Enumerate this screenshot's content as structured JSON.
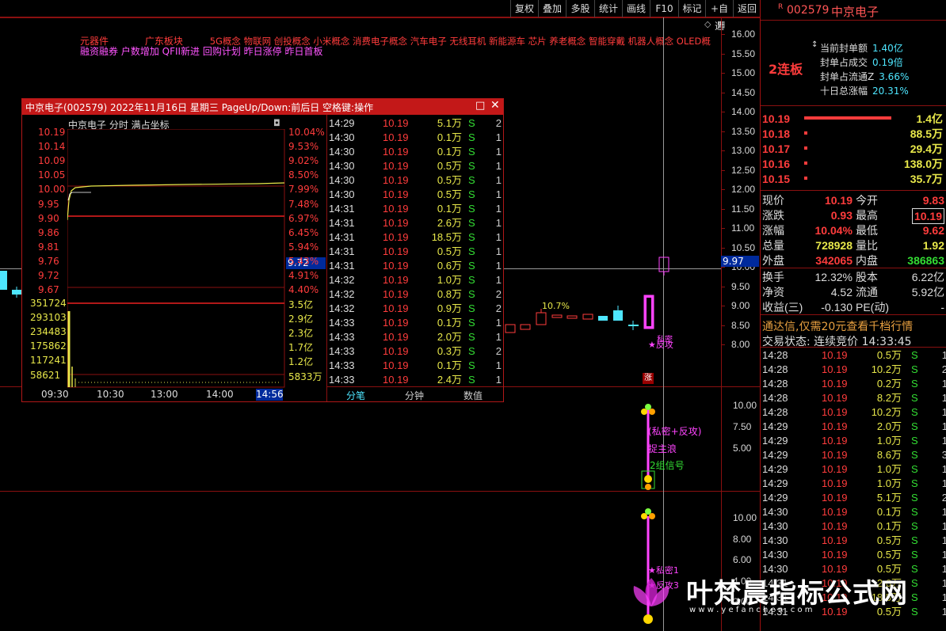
{
  "toolbar": {
    "items": [
      "复权",
      "叠加",
      "多股",
      "统计",
      "画线",
      "F10",
      "标记",
      "+自选",
      "返回"
    ]
  },
  "stock": {
    "badge": "R",
    "code": "002579",
    "name": "中京电子"
  },
  "concept_tags": {
    "line1": [
      {
        "t": "元器件",
        "c": "#ff3c3c"
      },
      {
        "t": "广东板块",
        "c": "#ff3c3c"
      },
      {
        "t": "5G概念 物联网 创投概念 小米概念 消费电子概念 汽车电子 无线耳机 新能源车 芯片 养老概念 智能穿戴 机器人概念 OLED概",
        "c": "#ff3c3c"
      }
    ],
    "line2": "融资融券 户数增加 QFII新进 回购计划 昨日涨停 昨日首板"
  },
  "main_axis": [
    "16.00",
    "15.50",
    "15.00",
    "14.50",
    "14.00",
    "13.50",
    "13.00",
    "12.50",
    "12.00",
    "11.50",
    "11.00",
    "10.50",
    "10.00",
    "9.50",
    "9.00",
    "8.50",
    "8.00"
  ],
  "price_box": "9.97",
  "pct_label": "10.7%",
  "signals": {
    "zhang": "涨",
    "rev": "★反攻",
    "ji": "私密",
    "s1": "(私密+反攻)",
    "s2": "捉主浪",
    "s3": "2组信号",
    "s4": "★私密1",
    "s5": "★反攻3"
  },
  "ind1_axis": [
    "10.00",
    "7.50",
    "5.00"
  ],
  "ind2_axis": [
    "10.00",
    "8.00",
    "6.00",
    "4.00",
    "2.00"
  ],
  "popup": {
    "title": "中京电子(002579)  2022年11月16日  星期三  PageUp/Down:前后日  空格键:操作",
    "chart_title": "中京电子  分时  满占坐标",
    "left_axis": [
      "10.19",
      "10.14",
      "10.09",
      "10.05",
      "10.00",
      "9.95",
      "9.90",
      "9.86",
      "9.81",
      "9.76",
      "9.72",
      "9.67"
    ],
    "right_axis": [
      "10.04%",
      "9.53%",
      "9.02%",
      "8.50%",
      "7.99%",
      "7.48%",
      "6.97%",
      "6.45%",
      "5.94%",
      "5.43%",
      "4.91%",
      "4.40%"
    ],
    "cur_price": "9.72",
    "vol_left": [
      "351724",
      "293103",
      "234483",
      "175862",
      "117241",
      "58621"
    ],
    "vol_right": [
      "3.5亿",
      "2.9亿",
      "2.3亿",
      "1.7亿",
      "1.2亿",
      "5833万"
    ],
    "times": [
      "09:30",
      "10:30",
      "13:00",
      "14:00"
    ],
    "time_end": "14:56",
    "ticks": [
      [
        "14:29",
        "10.19",
        "5.1万",
        "S",
        "2"
      ],
      [
        "14:30",
        "10.19",
        "0.1万",
        "S",
        "1"
      ],
      [
        "14:30",
        "10.19",
        "0.1万",
        "S",
        "1"
      ],
      [
        "14:30",
        "10.19",
        "0.5万",
        "S",
        "1"
      ],
      [
        "14:30",
        "10.19",
        "0.5万",
        "S",
        "1"
      ],
      [
        "14:30",
        "10.19",
        "0.5万",
        "S",
        "1"
      ],
      [
        "14:31",
        "10.19",
        "0.1万",
        "S",
        "1"
      ],
      [
        "14:31",
        "10.19",
        "2.6万",
        "S",
        "1"
      ],
      [
        "14:31",
        "10.19",
        "18.5万",
        "S",
        "1"
      ],
      [
        "14:31",
        "10.19",
        "0.5万",
        "S",
        "1"
      ],
      [
        "14:31",
        "10.19",
        "0.6万",
        "S",
        "1"
      ],
      [
        "14:32",
        "10.19",
        "1.0万",
        "S",
        "1"
      ],
      [
        "14:32",
        "10.19",
        "0.8万",
        "S",
        "2"
      ],
      [
        "14:32",
        "10.19",
        "0.9万",
        "S",
        "2"
      ],
      [
        "14:33",
        "10.19",
        "0.1万",
        "S",
        "1"
      ],
      [
        "14:33",
        "10.19",
        "2.0万",
        "S",
        "1"
      ],
      [
        "14:33",
        "10.19",
        "0.3万",
        "S",
        "2"
      ],
      [
        "14:33",
        "10.19",
        "0.1万",
        "S",
        "1"
      ],
      [
        "14:33",
        "10.19",
        "2.4万",
        "S",
        "1"
      ]
    ],
    "tabs": [
      "分笔",
      "分钟",
      "数值"
    ]
  },
  "side": {
    "board": "2连板",
    "seal": [
      [
        "当前封单额",
        "1.40亿"
      ],
      [
        "封单占成交",
        "0.19倍"
      ],
      [
        "封单占流通Z",
        "3.66%"
      ],
      [
        "十日总涨幅",
        "20.31%"
      ]
    ],
    "book": [
      [
        "10.19",
        "1.4亿"
      ],
      [
        "10.18",
        "88.5万"
      ],
      [
        "10.17",
        "29.4万"
      ],
      [
        "10.16",
        "138.0万"
      ],
      [
        "10.15",
        "35.7万"
      ]
    ],
    "quote": [
      [
        "现价",
        "10.19",
        "今开",
        "9.83"
      ],
      [
        "涨跌",
        "0.93",
        "最高",
        "10.19"
      ],
      [
        "涨幅",
        "10.04%",
        "最低",
        "9.62"
      ],
      [
        "总量",
        "728928",
        "量比",
        "1.92"
      ],
      [
        "外盘",
        "342065",
        "内盘",
        "386863"
      ]
    ],
    "fund": [
      [
        "换手",
        "12.32%",
        "股本",
        "6.22亿"
      ],
      [
        "净资",
        "4.52",
        "流通",
        "5.92亿"
      ],
      [
        "收益(三)",
        "-0.130",
        "PE(动)",
        "-"
      ]
    ],
    "promo": "通达信,仅需20元查看千档行情",
    "status_label": "交易状态: 连续竞价",
    "status_time": "14:33:45",
    "ticks": [
      [
        "14:28",
        "10.19",
        "0.5万",
        "S",
        "1"
      ],
      [
        "14:28",
        "10.19",
        "10.2万",
        "S",
        "2"
      ],
      [
        "14:28",
        "10.19",
        "0.2万",
        "S",
        "1"
      ],
      [
        "14:28",
        "10.19",
        "8.2万",
        "S",
        "1"
      ],
      [
        "14:28",
        "10.19",
        "10.2万",
        "S",
        "1"
      ],
      [
        "14:29",
        "10.19",
        "2.0万",
        "S",
        "1"
      ],
      [
        "14:29",
        "10.19",
        "1.0万",
        "S",
        "1"
      ],
      [
        "14:29",
        "10.19",
        "8.6万",
        "S",
        "3"
      ],
      [
        "14:29",
        "10.19",
        "1.0万",
        "S",
        "1"
      ],
      [
        "14:29",
        "10.19",
        "1.0万",
        "S",
        "1"
      ],
      [
        "14:29",
        "10.19",
        "5.1万",
        "S",
        "2"
      ],
      [
        "14:30",
        "10.19",
        "0.1万",
        "S",
        "1"
      ],
      [
        "14:30",
        "10.19",
        "0.1万",
        "S",
        "1"
      ],
      [
        "14:30",
        "10.19",
        "0.5万",
        "S",
        "1"
      ],
      [
        "14:30",
        "10.19",
        "0.5万",
        "S",
        "1"
      ],
      [
        "14:30",
        "10.19",
        "0.5万",
        "S",
        "1"
      ],
      [
        "14:31",
        "10.19",
        "2.6万",
        "S",
        "1"
      ],
      [
        "14:31",
        "10.19",
        "18.5万",
        "S",
        "1"
      ],
      [
        "14:31",
        "10.19",
        "0.5万",
        "S",
        "1"
      ]
    ]
  },
  "watermark": {
    "title": "叶梵晨指标公式网",
    "url": "w w w . y e f a n c h e n . c o m"
  }
}
